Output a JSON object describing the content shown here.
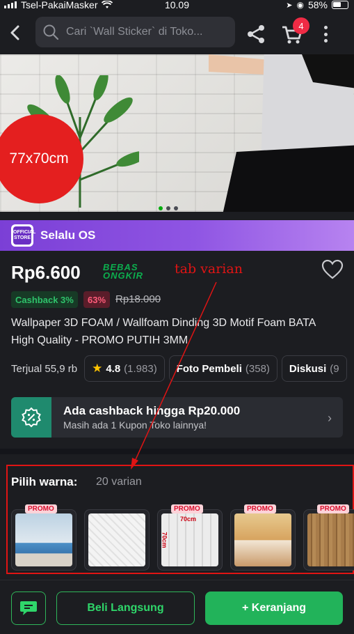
{
  "status_bar": {
    "carrier": "Tsel-PakaiMasker",
    "time": "10.09",
    "battery": "58%"
  },
  "header": {
    "search_placeholder": "Cari `Wall Sticker` di Toko...",
    "cart_count": "4"
  },
  "hero": {
    "size_badge": "77x70cm",
    "carousel_active_index": 0
  },
  "shop_banner": {
    "logo_text": "OFFICIAL STORE",
    "label": "Selalu OS"
  },
  "product": {
    "price": "Rp6.600",
    "free_shipping_line1": "BEBAS",
    "free_shipping_line2": "ONGKIR",
    "cashback_chip": "Cashback 3%",
    "discount_chip": "63%",
    "original_price": "Rp18.000",
    "title": "Wallpaper 3D FOAM / Wallfoam Dinding 3D Motif Foam BATA High Quality - PROMO PUTIH 3MM"
  },
  "stats": {
    "sold": "Terjual 55,9 rb",
    "rating": "4.8",
    "rating_count": "(1.983)",
    "photos_label": "Foto Pembeli",
    "photos_count": "(358)",
    "discussion_label": "Diskusi",
    "discussion_count": "(9"
  },
  "cashback_card": {
    "title": "Ada cashback hingga Rp20.000",
    "subtitle": "Masih ada 1 Kupon Toko lainnya!"
  },
  "variants": {
    "heading": "Pilih warna:",
    "count": "20 varian",
    "promo_label": "PROMO",
    "thumb_texts": [
      "70cm",
      "70cm"
    ]
  },
  "annotation": {
    "text": "tab varian"
  },
  "bottom_bar": {
    "buy_now": "Beli Langsung",
    "add_to_cart": "+ Keranjang"
  },
  "colors": {
    "primary_green": "#22b35a",
    "annotation_red": "#e01414",
    "shop_banner_purple": "#8f55e3"
  }
}
